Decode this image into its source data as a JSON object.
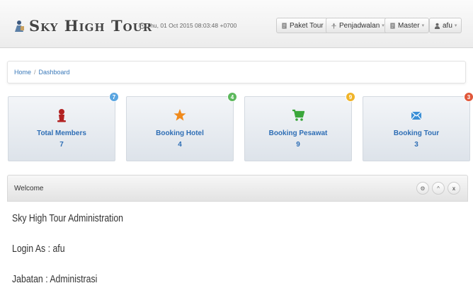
{
  "brand": {
    "name": "Sky High Tour",
    "icon": "tourist-icon"
  },
  "header": {
    "datetime": "Thu, 01 Oct 2015 08:03:48 +0700",
    "datetime_icon": "clock-icon"
  },
  "nav": {
    "paket_tour": {
      "label": "Paket Tour",
      "icon": "document-icon"
    },
    "penjadwalan": {
      "label": "Penjadwalan",
      "icon": "pin-icon",
      "caret": "▾"
    },
    "master": {
      "label": "Master",
      "icon": "document-icon",
      "caret": "▾"
    },
    "user": {
      "label": "afu",
      "icon": "user-icon",
      "caret": "▾"
    }
  },
  "breadcrumb": {
    "home": "Home",
    "separator": "/",
    "current": "Dashboard"
  },
  "tiles": [
    {
      "title": "Total Members",
      "count": "7",
      "badge": "7",
      "icon": "user-icon",
      "icon_color": "#b22222",
      "badge_color": "#5aa5e0"
    },
    {
      "title": "Booking Hotel",
      "count": "4",
      "badge": "4",
      "icon": "star-icon",
      "icon_color": "#f08a1c",
      "badge_color": "#5cb85c"
    },
    {
      "title": "Booking Pesawat",
      "count": "9",
      "badge": "9",
      "icon": "cart-icon",
      "icon_color": "#3aa63a",
      "badge_color": "#f0b429"
    },
    {
      "title": "Booking Tour",
      "count": "3",
      "badge": "3",
      "icon": "envelope-icon",
      "icon_color": "#3b8fd6",
      "badge_color": "#e0573a"
    }
  ],
  "panel": {
    "title": "Welcome",
    "actions": {
      "settings": "⚙",
      "collapse": "^",
      "close": "x"
    },
    "lines": [
      "Sky High Tour Administration",
      "Login As : afu",
      "Jabatan : Administrasi"
    ]
  }
}
